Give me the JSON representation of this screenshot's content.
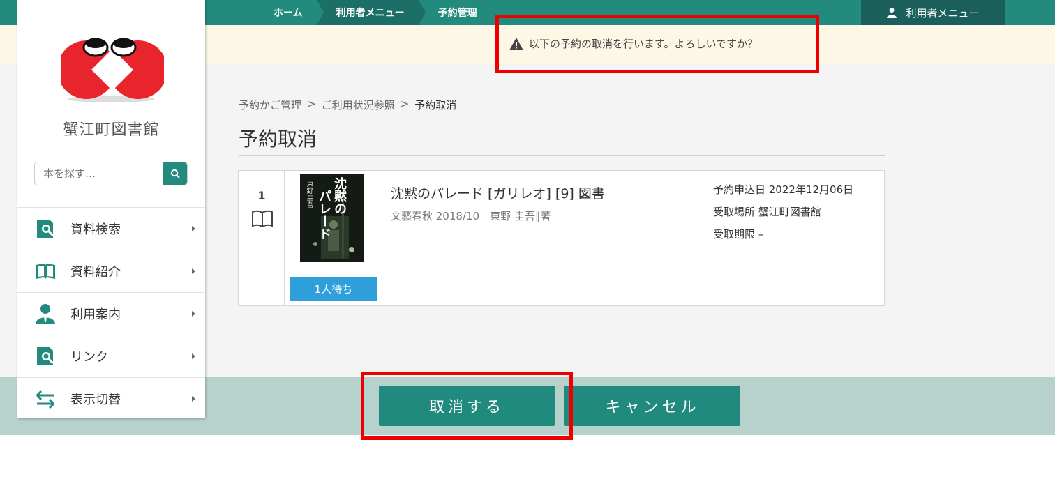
{
  "nav": {
    "crumbs": [
      "ホーム",
      "利用者メニュー",
      "予約管理"
    ],
    "user_menu": "利用者メニュー"
  },
  "notice": {
    "message": "以下の予約の取消を行います。よろしいですか？"
  },
  "sidebar": {
    "library_name": "蟹江町図書館",
    "search_placeholder": "本を探す…",
    "items": [
      {
        "label": "資料検索",
        "icon": "search-book-icon"
      },
      {
        "label": "資料紹介",
        "icon": "open-book-icon"
      },
      {
        "label": "利用案内",
        "icon": "person-icon"
      },
      {
        "label": "リンク",
        "icon": "search-book-icon"
      },
      {
        "label": "表示切替",
        "icon": "swap-arrows-icon"
      }
    ]
  },
  "breadcrumb": {
    "items": [
      "予約かご管理",
      "ご利用状況参照",
      "予約取消"
    ],
    "separator": ">"
  },
  "page": {
    "title": "予約取消"
  },
  "reservation": {
    "index": "1",
    "cover_title_line1": "沈黙の",
    "cover_title_line2": "パレード",
    "cover_author": "東野圭吾",
    "title": "沈黙のパレード [ガリレオ] [9] 図書",
    "meta": "文藝春秋 2018/10　東野 圭吾∥著",
    "wait_badge": "1人待ち",
    "applied_date": "予約申込日 2022年12月06日",
    "pickup_place": "受取場所 蟹江町図書館",
    "pickup_deadline": "受取期限 –"
  },
  "actions": {
    "confirm": "取消する",
    "cancel": "キャンセル"
  },
  "colors": {
    "accent": "#238a7e",
    "highlight": "#ee0000",
    "badge": "#2f9fdc"
  }
}
